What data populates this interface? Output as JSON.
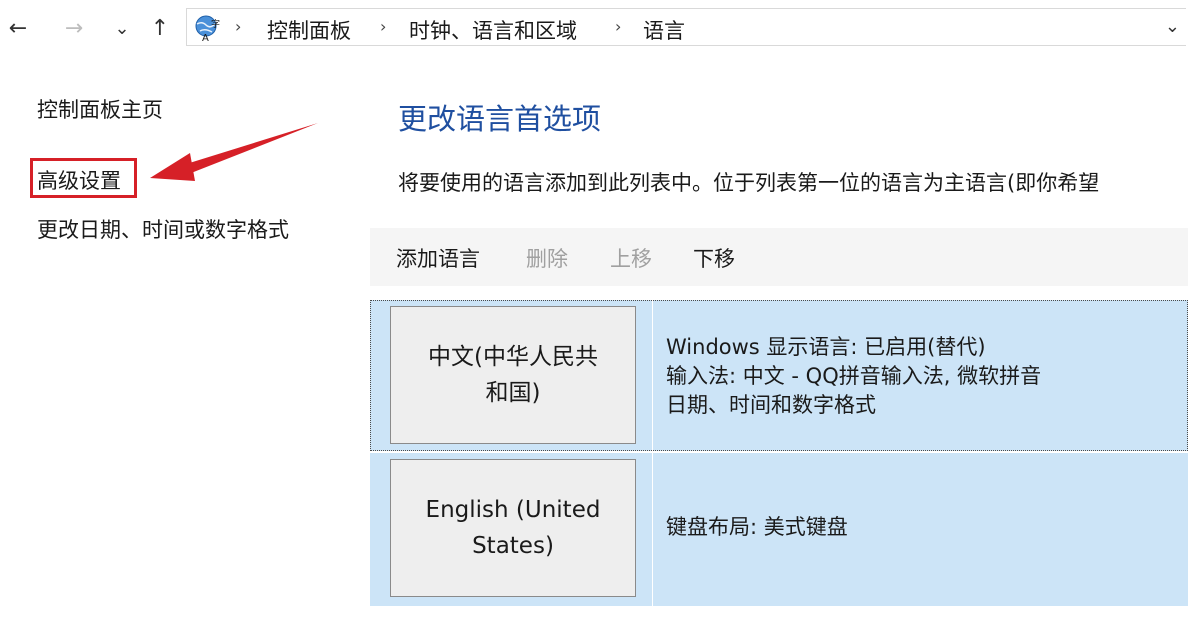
{
  "navigation": {
    "back_icon": "←",
    "forward_icon": "→",
    "recent_icon": "⌄",
    "up_icon": "↑",
    "breadcrumb": [
      "控制面板",
      "时钟、语言和区域",
      "语言"
    ],
    "separator": "›",
    "dropdown_icon": "⌄"
  },
  "sidebar": {
    "items": [
      {
        "label": "控制面板主页"
      },
      {
        "label": "高级设置",
        "highlighted": true
      },
      {
        "label": "更改日期、时间或数字格式"
      }
    ]
  },
  "main": {
    "heading": "更改语言首选项",
    "description": "将要使用的语言添加到此列表中。位于列表第一位的语言为主语言(即你希望",
    "toolbar": {
      "add": "添加语言",
      "remove": "删除",
      "move_up": "上移",
      "move_down": "下移"
    },
    "languages": [
      {
        "name_line1": "中文(中华人民共",
        "name_line2": "和国)",
        "details": [
          "Windows 显示语言: 已启用(替代)",
          "输入法: 中文 - QQ拼音输入法, 微软拼音",
          "日期、时间和数字格式"
        ],
        "selected": true
      },
      {
        "name_line1": "English (United",
        "name_line2": "States)",
        "details": [
          "键盘布局: 美式键盘"
        ],
        "selected": false
      }
    ]
  },
  "colors": {
    "heading": "#1f4fa0",
    "selection_bg": "#cce4f7",
    "annotation": "#d62027"
  }
}
